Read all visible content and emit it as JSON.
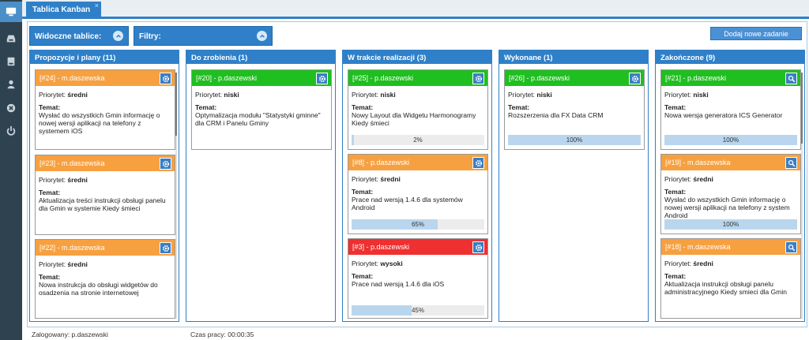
{
  "sidebar": {
    "items": [
      {
        "icon": "monitor-icon",
        "active": true
      },
      {
        "icon": "inbox-icon"
      },
      {
        "icon": "drive-icon"
      },
      {
        "icon": "user-icon"
      },
      {
        "icon": "cancel-icon"
      },
      {
        "icon": "power-icon"
      }
    ]
  },
  "tab": {
    "label": "Tablica Kanban",
    "close": "×"
  },
  "toolbar": {
    "visible_boards_label": "Widoczne tablice:",
    "filters_label": "Filtry:",
    "add_task_label": "Dodaj nowe zadanie"
  },
  "columns": [
    {
      "title": "Propozycje i plany (11)",
      "cards": [
        {
          "header": "[#24] - m.daszewska",
          "color": "orange",
          "priority_label": "Priorytet:",
          "priority": "średni",
          "topic_label": "Temat:",
          "topic": "Wysłać do wszystkich Gmin informację o nowej wersji aplikacji na telefony z systemem iOS",
          "action_icon": "gear-icon"
        },
        {
          "header": "[#23] - m.daszewska",
          "color": "orange",
          "priority_label": "Priorytet:",
          "priority": "średni",
          "topic_label": "Temat:",
          "topic": "Aktualizacja treści instrukcji obsługi panelu dla Gmin w systemie Kiedy śmieci",
          "action_icon": "gear-icon"
        },
        {
          "header": "[#22] - m.daszewska",
          "color": "orange",
          "priority_label": "Priorytet:",
          "priority": "średni",
          "topic_label": "Temat:",
          "topic": "Nowa instrukcja do obsługi widgetów do osadzenia na stronie internetowej",
          "action_icon": "gear-icon"
        }
      ]
    },
    {
      "title": "Do zrobienia (1)",
      "cards": [
        {
          "header": "[#20] - p.daszewski",
          "color": "green",
          "priority_label": "Priorytet:",
          "priority": "niski",
          "topic_label": "Temat:",
          "topic": "Optymalizacja modułu \"Statystyki gminne\" dla CRM i Panelu Gminy",
          "action_icon": "gear-icon"
        }
      ]
    },
    {
      "title": "W trakcie realizacji (3)",
      "cards": [
        {
          "header": "[#25] - p.daszewski",
          "color": "green",
          "priority_label": "Priorytet:",
          "priority": "niski",
          "topic_label": "Temat:",
          "topic": "Nowy Layout dla Widgetu Harmonogramy Kiedy śmieci",
          "progress": 2,
          "progress_label": "2%",
          "action_icon": "gear-icon"
        },
        {
          "header": "[#8] - p.daszewski",
          "color": "orange",
          "priority_label": "Priorytet:",
          "priority": "średni",
          "topic_label": "Temat:",
          "topic": "Prace nad wersją 1.4.6 dla systemów Android",
          "progress": 65,
          "progress_label": "65%",
          "action_icon": "gear-icon"
        },
        {
          "header": "[#3] - p.daszewski",
          "color": "red",
          "priority_label": "Priorytet:",
          "priority": "wysoki",
          "topic_label": "Temat:",
          "topic": "Prace nad wersją 1.4.6 dla iOS",
          "progress": 45,
          "progress_label": "45%",
          "action_icon": "gear-icon"
        }
      ]
    },
    {
      "title": "Wykonane (1)",
      "cards": [
        {
          "header": "[#26] - p.daszewski",
          "color": "green",
          "priority_label": "Priorytet:",
          "priority": "niski",
          "topic_label": "Temat:",
          "topic": "Rozszerzenia dla FX Data CRM",
          "progress": 100,
          "progress_label": "100%",
          "action_icon": "gear-icon"
        }
      ]
    },
    {
      "title": "Zakończone (9)",
      "cards": [
        {
          "header": "[#21] - p.daszewski",
          "color": "green",
          "priority_label": "Priorytet:",
          "priority": "niski",
          "topic_label": "Temat:",
          "topic": "Nowa wersja generatora ICS Generator",
          "progress": 100,
          "progress_label": "100%",
          "action_icon": "search-icon"
        },
        {
          "header": "[#19] - m.daszewska",
          "color": "orange",
          "priority_label": "Priorytet:",
          "priority": "średni",
          "topic_label": "Temat:",
          "topic": "Wysłać do wszystkich Gmin informację o nowej wersji aplikacji na telefony z system Android",
          "progress": 100,
          "progress_label": "100%",
          "action_icon": "search-icon"
        },
        {
          "header": "[#18] - m.daszewska",
          "color": "orange",
          "priority_label": "Priorytet:",
          "priority": "średni",
          "topic_label": "Temat:",
          "topic": "Aktualizacja instrukcji obsługi panelu administracyjnego Kiedy smieci dla Gmin",
          "action_icon": "search-icon"
        }
      ]
    }
  ],
  "statusbar": {
    "logged_in": "Zalogowany: p.daszewski",
    "work_time": "Czas pracy: 00:00:35"
  }
}
